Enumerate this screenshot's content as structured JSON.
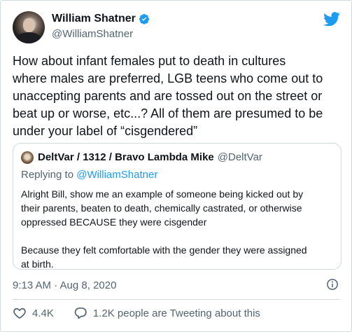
{
  "author": {
    "display_name": "William Shatner",
    "handle": "@WilliamShatner"
  },
  "tweet": {
    "text": "How about infant females put to death in cultures\nwhere males are preferred, LGB teens who come out to\nunaccepting parents and are tossed out on the street or\nbeat up or worse, etc...? All of them are presumed to be\nunder your label of “cisgendered”",
    "timestamp": "9:13 AM · Aug 8, 2020"
  },
  "quoted": {
    "display_name": "DeltVar / 1312 / Bravo Lambda Mike",
    "handle": "@DeltVar",
    "replying_prefix": "Replying to ",
    "replying_to": "@WilliamShatner",
    "text": "Alright Bill, show me an example of someone being kicked out by\ntheir parents, beaten to death, chemically castrated, or otherwise\noppressed BECAUSE they were cisgender\n\nBecause they felt comfortable with the gender they were assigned\nat birth."
  },
  "actions": {
    "likes": "4.4K",
    "replies_label": "1.2K people are Tweeting about this"
  },
  "icons": {
    "brand": "twitter-bird-icon",
    "verified": "verified-badge-icon",
    "info": "info-icon",
    "like": "heart-icon",
    "reply": "speech-bubble-icon"
  },
  "colors": {
    "brand": "#1d9bf0",
    "muted": "#536471",
    "text": "#0f1419",
    "border": "#cfd9de"
  }
}
